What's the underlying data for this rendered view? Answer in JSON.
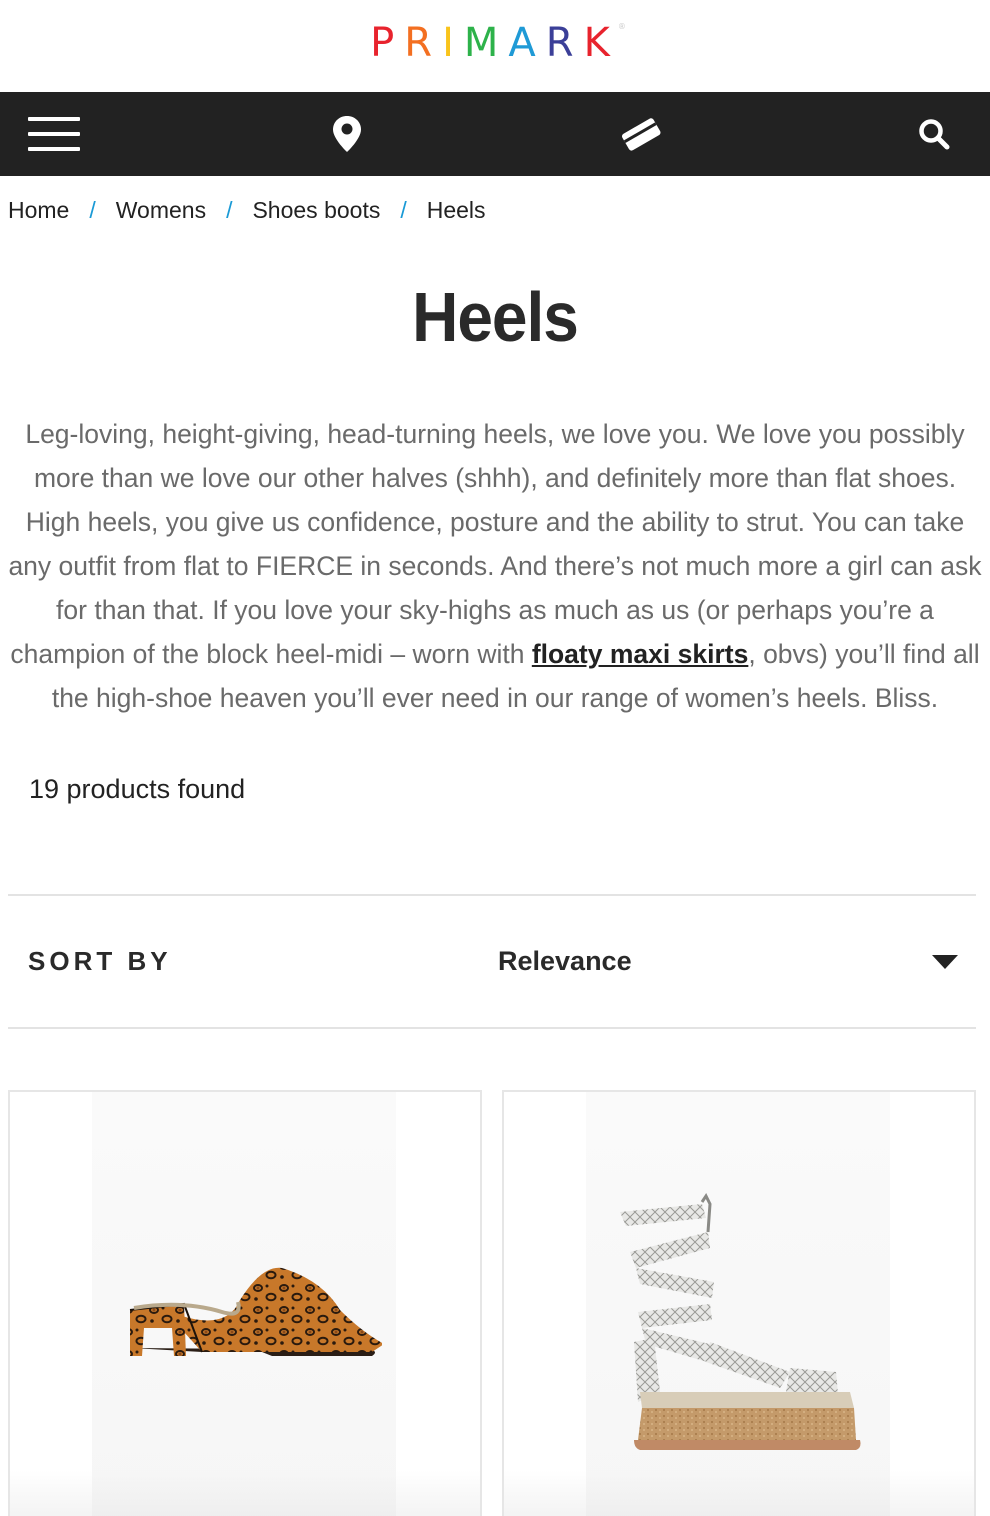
{
  "brand": {
    "letters": [
      {
        "char": "P",
        "color": "#e8232d"
      },
      {
        "char": "R",
        "color": "#f36f21"
      },
      {
        "char": "I",
        "color": "#f9c41b"
      },
      {
        "char": "M",
        "color": "#2db24a"
      },
      {
        "char": "A",
        "color": "#1f9ad6"
      },
      {
        "char": "R",
        "color": "#3b3f98"
      },
      {
        "char": "K",
        "color": "#e8232d"
      }
    ],
    "registered": "®"
  },
  "nav": {
    "icons": [
      "menu-icon",
      "location-pin-icon",
      "gift-card-icon",
      "search-icon"
    ]
  },
  "breadcrumb": {
    "items": [
      "Home",
      "Womens",
      "Shoes boots",
      "Heels"
    ],
    "separator": "/"
  },
  "page": {
    "title": "Heels",
    "description_before_link": "Leg-loving, height-giving, head-turning heels, we love you. We love you possibly more than we love our other halves (shhh), and definitely more than flat shoes. High heels, you give us confidence, posture and the ability to strut. You can take any outfit from flat to FIERCE in seconds. And there’s not much more a girl can ask for than that. If you love your sky-highs as much as us (or perhaps you’re a champion of the block heel-midi – worn with ",
    "description_link": "floaty maxi skirts",
    "description_after_link": ", obvs) you’ll find all the high-shoe heaven you’ll ever need in our range of women’s heels. Bliss.",
    "products_found": "19 products found"
  },
  "sort": {
    "label": "SORT BY",
    "selected": "Relevance"
  },
  "colors": {
    "nav_bg": "#222222",
    "separator": "#1a9ad6",
    "text": "#222222",
    "muted": "#6a6a6a"
  }
}
